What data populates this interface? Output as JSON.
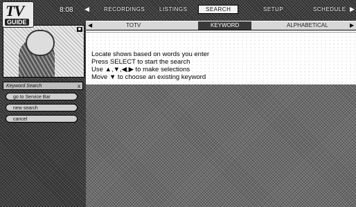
{
  "header": {
    "logo_top": "TV",
    "logo_bottom": "GUIDE",
    "time": "8:08",
    "menu": [
      {
        "label": "RECORDINGS",
        "active": false
      },
      {
        "label": "LISTINGS",
        "active": false
      },
      {
        "label": "SEARCH",
        "active": true
      },
      {
        "label": "SETUP",
        "active": false
      },
      {
        "label": "SCHEDULE",
        "active": false
      }
    ]
  },
  "video": {
    "channel_tag": "■"
  },
  "sidebar": {
    "title": "Keyword Search",
    "close": "x",
    "buttons": [
      "go to Service Bar",
      "new search",
      "cancel"
    ]
  },
  "tabs": {
    "items": [
      "TOTV",
      "KEYWORD",
      "ALPHABETICAL"
    ],
    "active_index": 1
  },
  "info": {
    "lines": [
      "Locate shows based on words you enter",
      "Press SELECT to start the search",
      "Use ▲,▼,◀,▶ to make selections",
      "Move ▼ to choose an existing keyword"
    ]
  }
}
